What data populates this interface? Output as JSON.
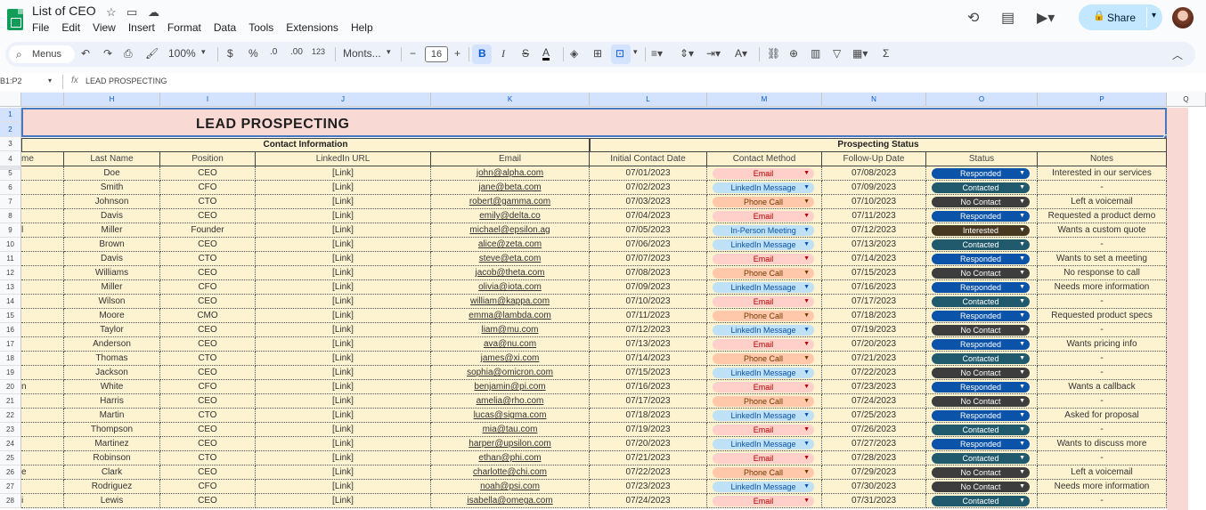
{
  "doc": {
    "title": "List of CEO"
  },
  "menu": [
    "File",
    "Edit",
    "View",
    "Insert",
    "Format",
    "Data",
    "Tools",
    "Extensions",
    "Help"
  ],
  "share": {
    "label": "Share"
  },
  "toolbar": {
    "search_label": "Menus",
    "zoom": "100%",
    "currency": "$",
    "percent": "%",
    "dec_decrease": ".0",
    "dec_increase": ".00",
    "number_format": "123",
    "font": "Monts...",
    "font_size": "16"
  },
  "formula_bar": {
    "name_box": "B1:P2",
    "value": "LEAD PROSPECTING"
  },
  "columns": [
    "H",
    "I",
    "J",
    "K",
    "L",
    "M",
    "N",
    "O",
    "P",
    "Q"
  ],
  "rows": [
    "1",
    "2",
    "3",
    "4",
    "5",
    "6",
    "7",
    "8",
    "9",
    "10",
    "11",
    "12",
    "13",
    "14",
    "15",
    "16",
    "17",
    "18",
    "19",
    "20",
    "21",
    "22",
    "23",
    "24",
    "25",
    "26",
    "27",
    "28"
  ],
  "sheet": {
    "title": "LEAD PROSPECTING",
    "group_contact": "Contact Information",
    "group_status": "Prospecting Status",
    "headers": [
      "me",
      "Last Name",
      "Position",
      "LinkedIn URL",
      "Email",
      "Initial Contact Date",
      "Contact Method",
      "Follow-Up Date",
      "Status",
      "Notes"
    ],
    "records": [
      {
        "first": "",
        "last": "Doe",
        "position": "CEO",
        "linkedin": "[Link]",
        "email": "john@alpha.com",
        "initial": "07/01/2023",
        "method": "Email",
        "follow": "07/08/2023",
        "status": "Responded",
        "notes": "Interested in our services"
      },
      {
        "first": "",
        "last": "Smith",
        "position": "CFO",
        "linkedin": "[Link]",
        "email": "jane@beta.com",
        "initial": "07/02/2023",
        "method": "LinkedIn Message",
        "follow": "07/09/2023",
        "status": "Contacted",
        "notes": "-"
      },
      {
        "first": "",
        "last": "Johnson",
        "position": "CTO",
        "linkedin": "[Link]",
        "email": "robert@gamma.com",
        "initial": "07/03/2023",
        "method": "Phone Call",
        "follow": "07/10/2023",
        "status": "No Contact",
        "notes": "Left a voicemail"
      },
      {
        "first": "",
        "last": "Davis",
        "position": "CEO",
        "linkedin": "[Link]",
        "email": "emily@delta.co",
        "initial": "07/04/2023",
        "method": "Email",
        "follow": "07/11/2023",
        "status": "Responded",
        "notes": "Requested a product demo"
      },
      {
        "first": "l",
        "last": "Miller",
        "position": "Founder",
        "linkedin": "[Link]",
        "email": "michael@epsilon.ag",
        "initial": "07/05/2023",
        "method": "In-Person Meeting",
        "follow": "07/12/2023",
        "status": "Interested",
        "notes": "Wants a custom quote"
      },
      {
        "first": "",
        "last": "Brown",
        "position": "CEO",
        "linkedin": "[Link]",
        "email": "alice@zeta.com",
        "initial": "07/06/2023",
        "method": "LinkedIn Message",
        "follow": "07/13/2023",
        "status": "Contacted",
        "notes": "-"
      },
      {
        "first": "",
        "last": "Davis",
        "position": "CTO",
        "linkedin": "[Link]",
        "email": "steve@eta.com",
        "initial": "07/07/2023",
        "method": "Email",
        "follow": "07/14/2023",
        "status": "Responded",
        "notes": "Wants to set a meeting"
      },
      {
        "first": "",
        "last": "Williams",
        "position": "CEO",
        "linkedin": "[Link]",
        "email": "jacob@theta.com",
        "initial": "07/08/2023",
        "method": "Phone Call",
        "follow": "07/15/2023",
        "status": "No Contact",
        "notes": "No response to call"
      },
      {
        "first": "",
        "last": "Miller",
        "position": "CFO",
        "linkedin": "[Link]",
        "email": "olivia@iota.com",
        "initial": "07/09/2023",
        "method": "LinkedIn Message",
        "follow": "07/16/2023",
        "status": "Responded",
        "notes": "Needs more information"
      },
      {
        "first": "",
        "last": "Wilson",
        "position": "CEO",
        "linkedin": "[Link]",
        "email": "william@kappa.com",
        "initial": "07/10/2023",
        "method": "Email",
        "follow": "07/17/2023",
        "status": "Contacted",
        "notes": "-"
      },
      {
        "first": "",
        "last": "Moore",
        "position": "CMO",
        "linkedin": "[Link]",
        "email": "emma@lambda.com",
        "initial": "07/11/2023",
        "method": "Phone Call",
        "follow": "07/18/2023",
        "status": "Responded",
        "notes": "Requested product specs"
      },
      {
        "first": "",
        "last": "Taylor",
        "position": "CEO",
        "linkedin": "[Link]",
        "email": "liam@mu.com",
        "initial": "07/12/2023",
        "method": "LinkedIn Message",
        "follow": "07/19/2023",
        "status": "No Contact",
        "notes": "-"
      },
      {
        "first": "",
        "last": "Anderson",
        "position": "CEO",
        "linkedin": "[Link]",
        "email": "ava@nu.com",
        "initial": "07/13/2023",
        "method": "Email",
        "follow": "07/20/2023",
        "status": "Responded",
        "notes": "Wants pricing info"
      },
      {
        "first": "",
        "last": "Thomas",
        "position": "CTO",
        "linkedin": "[Link]",
        "email": "james@xi.com",
        "initial": "07/14/2023",
        "method": "Phone Call",
        "follow": "07/21/2023",
        "status": "Contacted",
        "notes": "-"
      },
      {
        "first": "",
        "last": "Jackson",
        "position": "CEO",
        "linkedin": "[Link]",
        "email": "sophia@omicron.com",
        "initial": "07/15/2023",
        "method": "LinkedIn Message",
        "follow": "07/22/2023",
        "status": "No Contact",
        "notes": "-"
      },
      {
        "first": "n",
        "last": "White",
        "position": "CFO",
        "linkedin": "[Link]",
        "email": "benjamin@pi.com",
        "initial": "07/16/2023",
        "method": "Email",
        "follow": "07/23/2023",
        "status": "Responded",
        "notes": "Wants a callback"
      },
      {
        "first": "",
        "last": "Harris",
        "position": "CEO",
        "linkedin": "[Link]",
        "email": "amelia@rho.com",
        "initial": "07/17/2023",
        "method": "Phone Call",
        "follow": "07/24/2023",
        "status": "No Contact",
        "notes": "-"
      },
      {
        "first": "",
        "last": "Martin",
        "position": "CTO",
        "linkedin": "[Link]",
        "email": "lucas@sigma.com",
        "initial": "07/18/2023",
        "method": "LinkedIn Message",
        "follow": "07/25/2023",
        "status": "Responded",
        "notes": "Asked for proposal"
      },
      {
        "first": "",
        "last": "Thompson",
        "position": "CEO",
        "linkedin": "[Link]",
        "email": "mia@tau.com",
        "initial": "07/19/2023",
        "method": "Email",
        "follow": "07/26/2023",
        "status": "Contacted",
        "notes": "-"
      },
      {
        "first": "",
        "last": "Martinez",
        "position": "CEO",
        "linkedin": "[Link]",
        "email": "harper@upsilon.com",
        "initial": "07/20/2023",
        "method": "LinkedIn Message",
        "follow": "07/27/2023",
        "status": "Responded",
        "notes": "Wants to discuss more"
      },
      {
        "first": "",
        "last": "Robinson",
        "position": "CTO",
        "linkedin": "[Link]",
        "email": "ethan@phi.com",
        "initial": "07/21/2023",
        "method": "Email",
        "follow": "07/28/2023",
        "status": "Contacted",
        "notes": "-"
      },
      {
        "first": "e",
        "last": "Clark",
        "position": "CEO",
        "linkedin": "[Link]",
        "email": "charlotte@chi.com",
        "initial": "07/22/2023",
        "method": "Phone Call",
        "follow": "07/29/2023",
        "status": "No Contact",
        "notes": "Left a voicemail"
      },
      {
        "first": "",
        "last": "Rodriguez",
        "position": "CFO",
        "linkedin": "[Link]",
        "email": "noah@psi.com",
        "initial": "07/23/2023",
        "method": "LinkedIn Message",
        "follow": "07/30/2023",
        "status": "No Contact",
        "notes": "Needs more information"
      },
      {
        "first": "i",
        "last": "Lewis",
        "position": "CEO",
        "linkedin": "[Link]",
        "email": "isabella@omega.com",
        "initial": "07/24/2023",
        "method": "Email",
        "follow": "07/31/2023",
        "status": "Contacted",
        "notes": "-"
      }
    ]
  },
  "colors": {
    "title_bg": "#f8d9d4",
    "table_bg": "#fdf3d0",
    "selection": "#4a78c0",
    "share_bg": "#c2e7ff"
  }
}
